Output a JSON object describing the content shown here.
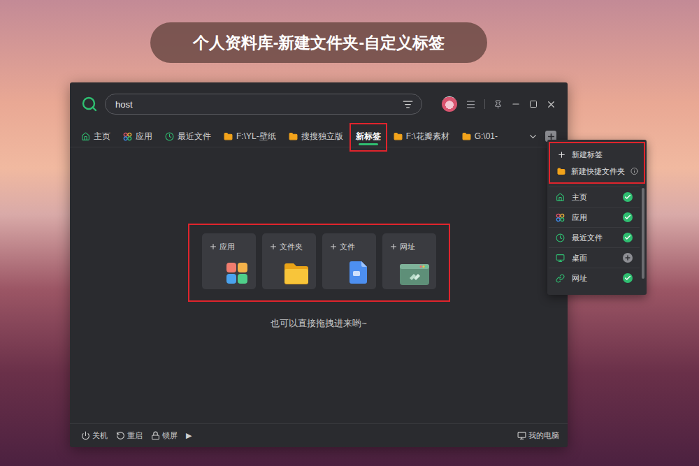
{
  "banner": {
    "title": "个人资料库-新建文件夹-自定义标签"
  },
  "search": {
    "value": "host"
  },
  "tabs": [
    {
      "label": "主页",
      "kind": "view",
      "selected": false
    },
    {
      "label": "应用",
      "kind": "view",
      "selected": false
    },
    {
      "label": "最近文件",
      "kind": "view",
      "selected": false
    },
    {
      "label": "F:\\YL-壁纸",
      "kind": "folder",
      "selected": false
    },
    {
      "label": "搜搜独立版",
      "kind": "folder",
      "selected": false
    },
    {
      "label": "新标签",
      "kind": "blank",
      "selected": true
    },
    {
      "label": "F:\\花瓣素材",
      "kind": "folder",
      "selected": false
    },
    {
      "label": "G:\\01-",
      "kind": "folder",
      "selected": false
    }
  ],
  "menu": {
    "actions": [
      {
        "label": "新建标签"
      },
      {
        "label": "新建快捷文件夹"
      }
    ],
    "items": [
      {
        "label": "主页",
        "checked": true
      },
      {
        "label": "应用",
        "checked": true
      },
      {
        "label": "最近文件",
        "checked": true
      },
      {
        "label": "桌面",
        "checked": false
      },
      {
        "label": "网址",
        "checked": true
      }
    ]
  },
  "add_cards": [
    {
      "label": "应用"
    },
    {
      "label": "文件夹"
    },
    {
      "label": "文件"
    },
    {
      "label": "网址"
    }
  ],
  "hint": "也可以直接拖拽进来哟~",
  "footer": {
    "actions": [
      {
        "label": "关机"
      },
      {
        "label": "重启"
      },
      {
        "label": "锁屏"
      }
    ],
    "more": "▶",
    "computer": "我的电脑"
  }
}
